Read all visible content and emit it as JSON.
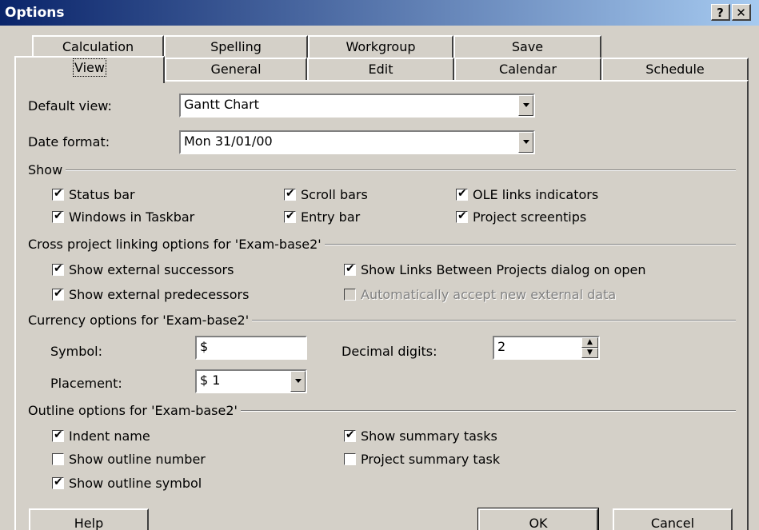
{
  "window": {
    "title": "Options",
    "help_glyph": "?",
    "close_glyph": "✕"
  },
  "tabs_back": [
    "Calculation",
    "Spelling",
    "Workgroup",
    "Save"
  ],
  "tabs_front": [
    "View",
    "General",
    "Edit",
    "Calendar",
    "Schedule"
  ],
  "active_tab": "View",
  "default_view": {
    "label": "Default view:",
    "value": "Gantt Chart"
  },
  "date_format": {
    "label": "Date format:",
    "value": "Mon 31/01/00"
  },
  "show": {
    "title": "Show",
    "items": [
      {
        "label": "Status bar",
        "checked": true
      },
      {
        "label": "Scroll bars",
        "checked": true
      },
      {
        "label": "OLE links indicators",
        "checked": true
      },
      {
        "label": "Windows in Taskbar",
        "checked": true
      },
      {
        "label": "Entry bar",
        "checked": true
      },
      {
        "label": "Project screentips",
        "checked": true
      }
    ]
  },
  "cross": {
    "title": "Cross project linking options for 'Exam-base2'",
    "items": [
      {
        "label": "Show external successors",
        "checked": true
      },
      {
        "label": "Show Links Between Projects dialog on open",
        "checked": true
      },
      {
        "label": "Show external predecessors",
        "checked": true
      },
      {
        "label": "Automatically accept new external data",
        "checked": false,
        "disabled": true
      }
    ]
  },
  "currency": {
    "title": "Currency options for 'Exam-base2'",
    "symbol_label": "Symbol:",
    "symbol_value": "$",
    "decimal_label": "Decimal digits:",
    "decimal_value": "2",
    "placement_label": "Placement:",
    "placement_value": "$ 1"
  },
  "outline": {
    "title": "Outline options for 'Exam-base2'",
    "items": [
      {
        "label": "Indent name",
        "checked": true
      },
      {
        "label": "Show summary tasks",
        "checked": true
      },
      {
        "label": "Show outline number",
        "checked": false
      },
      {
        "label": "Project summary task",
        "checked": false
      },
      {
        "label": "Show outline symbol",
        "checked": true
      }
    ]
  },
  "buttons": {
    "help": "Help",
    "ok": "OK",
    "cancel": "Cancel"
  }
}
